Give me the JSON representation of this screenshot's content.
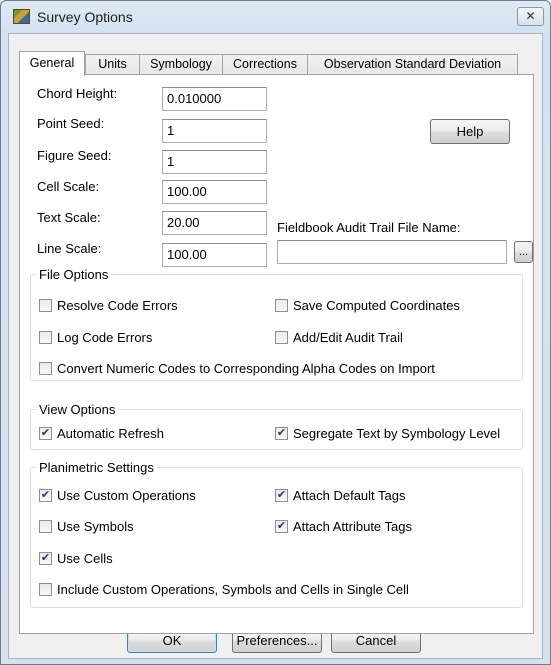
{
  "window": {
    "title": "Survey Options",
    "app_icon": "survey-app-icon",
    "close_glyph": "✕"
  },
  "tabs": [
    "General",
    "Units",
    "Symbology",
    "Corrections",
    "Observation Standard Deviation"
  ],
  "general": {
    "chord_height": {
      "label": "Chord Height:",
      "value": "0.010000"
    },
    "point_seed": {
      "label": "Point Seed:",
      "value": "1"
    },
    "figure_seed": {
      "label": "Figure Seed:",
      "value": "1"
    },
    "cell_scale": {
      "label": "Cell Scale:",
      "value": "100.00"
    },
    "text_scale": {
      "label": "Text Scale:",
      "value": "20.00"
    },
    "line_scale": {
      "label": "Line Scale:",
      "value": "100.00"
    },
    "help_label": "Help",
    "audit_trail": {
      "label": "Fieldbook Audit Trail File Name:",
      "value": "",
      "browse_label": "..."
    }
  },
  "file_options": {
    "title": "File Options",
    "items": [
      {
        "label": "Resolve Code Errors",
        "checked": false
      },
      {
        "label": "Save Computed Coordinates",
        "checked": false
      },
      {
        "label": "Log Code Errors",
        "checked": false
      },
      {
        "label": "Add/Edit Audit Trail",
        "checked": false
      },
      {
        "label": "Convert Numeric Codes to Corresponding Alpha Codes on Import",
        "checked": false
      }
    ]
  },
  "view_options": {
    "title": "View Options",
    "items": [
      {
        "label": "Automatic Refresh",
        "checked": true
      },
      {
        "label": "Segregate Text by Symbology Level",
        "checked": true
      }
    ]
  },
  "planimetric": {
    "title": "Planimetric Settings",
    "items": [
      {
        "label": "Use Custom Operations",
        "checked": true
      },
      {
        "label": "Attach Default Tags",
        "checked": true
      },
      {
        "label": "Use Symbols",
        "checked": false
      },
      {
        "label": "Attach Attribute Tags",
        "checked": true
      },
      {
        "label": "Use Cells",
        "checked": true
      },
      {
        "label": "Include Custom Operations, Symbols and Cells in Single Cell",
        "checked": false
      }
    ]
  },
  "footer": {
    "ok_label": "OK",
    "preferences_label": "Preferences...",
    "cancel_label": "Cancel"
  },
  "check_glyph": "✔"
}
